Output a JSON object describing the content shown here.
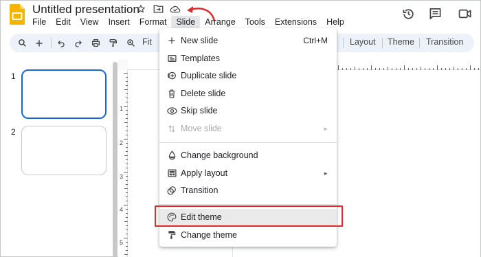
{
  "app": {
    "title": "Untitled presentation",
    "title_icons": [
      "star-icon",
      "folder-move-icon",
      "cloud-icon"
    ],
    "header_icons": [
      "history-icon",
      "comments-icon",
      "meet-icon"
    ]
  },
  "menubar": {
    "items": [
      "File",
      "Edit",
      "View",
      "Insert",
      "Format",
      "Slide",
      "Arrange",
      "Tools",
      "Extensions",
      "Help"
    ],
    "active": "Slide"
  },
  "toolbar": {
    "zoom_label": "Fit",
    "right_buttons": [
      "Layout",
      "Theme",
      "Transition"
    ]
  },
  "filmstrip": {
    "slides": [
      {
        "number": "1",
        "selected": true
      },
      {
        "number": "2",
        "selected": false
      }
    ]
  },
  "ruler": {
    "vertical_labels": [
      "1",
      "2",
      "3",
      "4",
      "5"
    ]
  },
  "slide_menu": {
    "items": [
      {
        "label": "New slide",
        "icon": "plus-icon",
        "shortcut": "Ctrl+M"
      },
      {
        "label": "Templates",
        "icon": "templates-icon"
      },
      {
        "label": "Duplicate slide",
        "icon": "duplicate-icon"
      },
      {
        "label": "Delete slide",
        "icon": "trash-icon"
      },
      {
        "label": "Skip slide",
        "icon": "eye-icon"
      },
      {
        "label": "Move slide",
        "icon": "move-icon",
        "disabled": true,
        "submenu": true
      },
      {
        "label": "Change background",
        "icon": "background-icon"
      },
      {
        "label": "Apply layout",
        "icon": "layout-icon",
        "submenu": true
      },
      {
        "label": "Transition",
        "icon": "transition-icon"
      },
      {
        "label": "Edit theme",
        "icon": "palette-icon",
        "highlighted": true
      },
      {
        "label": "Change theme",
        "icon": "paint-roller-icon"
      }
    ],
    "submenu_arrow": "►"
  },
  "colors": {
    "accent_blue": "#1a66d2",
    "annotation_red": "#e02a2a",
    "toolbar_bg": "#edf2fa",
    "slides_yellow": "#f4b400"
  }
}
